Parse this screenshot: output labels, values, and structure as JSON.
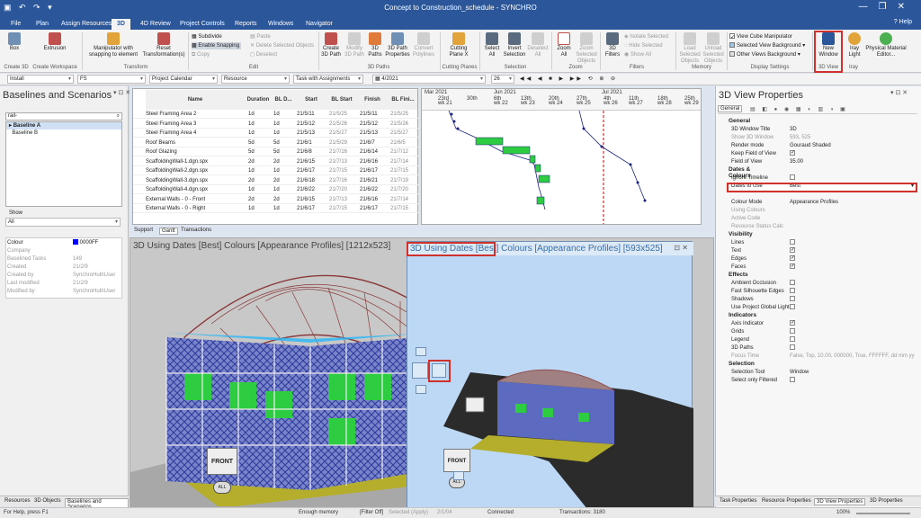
{
  "window": {
    "title": "Concept to Construction_schedule - SYNCHRO",
    "controls": [
      "—",
      "❐",
      "✕"
    ]
  },
  "menu": {
    "tabs": [
      "File",
      "Plan",
      "Assign Resources",
      "3D",
      "4D Review",
      "Project Controls",
      "Reports",
      "Windows",
      "Navigator"
    ],
    "active": "3D",
    "help": "Help"
  },
  "ribbon": {
    "box": "Box",
    "extrusion": "Extrusion",
    "create3d": "Create 3D",
    "create_workspace": "Create Workspace",
    "manipulator": "Manipulator with snapping to element",
    "reset": "Reset Transformation(s)",
    "transform": "Transform",
    "subdivide": "Subdivide",
    "enable_snapping": "Enable Snapping",
    "copy": "Copy",
    "paste": "Paste",
    "delete_selected": "Delete Selected Objects",
    "deselect": "Deselect",
    "edit": "Edit",
    "create_path": "Create 3D Path",
    "modify_path": "Modify 3D Path",
    "paths": "3D Paths",
    "path_props": "3D Path Properties",
    "convert_polylines": "Convert Polylines",
    "paths_group": "3D Paths",
    "cutting_plane": "Cutting Plane X",
    "cutting_planes": "Cutting Planes",
    "select_all": "Select All",
    "invert": "Invert Selection",
    "deselect_all": "Deselect All",
    "selection": "Selection",
    "zoom_all": "Zoom All",
    "zoom_selected": "Zoom Selected Objects",
    "zoom": "Zoom",
    "filters3d": "3D Filters",
    "isolate": "Isolate Selected",
    "hide": "Hide Selected",
    "show_all": "Show All",
    "filters": "Filters",
    "load": "Load Selected Objects",
    "unload": "Unload Selected Objects",
    "memory": "Memory",
    "view_cube": "View Cube Manipulator",
    "sel_bg": "Selected View Background",
    "other_bg": "Other Views Background",
    "display_settings": "Display Settings",
    "new_window": "New Window",
    "view3d": "3D View",
    "iray_light": "Iray Light",
    "iray": "Iray",
    "physical": "Physical Material Editor..."
  },
  "toolbar2": [
    "Install",
    "FS",
    "Project Calendar",
    "Resource",
    "Task with Assignments",
    "4/2021",
    "26"
  ],
  "left_panel": {
    "title": "Baselines and Scenarios",
    "search": "rail-",
    "baselines": [
      "Baseline A",
      "Baseline B"
    ],
    "show_label": "Show",
    "show_value": "All",
    "props": [
      {
        "k": "Colour",
        "v": "0000FF"
      },
      {
        "k": "Company",
        "v": ""
      },
      {
        "k": "Baselined Tasks",
        "v": "149"
      },
      {
        "k": "Created",
        "v": "21/2/9"
      },
      {
        "k": "Created by",
        "v": "SynchroHub\\User"
      },
      {
        "k": "Last modified",
        "v": "21/2/9"
      },
      {
        "k": "Modified by",
        "v": "SynchroHub\\User"
      }
    ],
    "tabs": [
      "Resources",
      "3D Objects",
      "Baselines and Scenarios"
    ]
  },
  "grid": {
    "headers": [
      "Name",
      "Duration",
      "BL D...",
      "Start",
      "BL Start",
      "Finish",
      "BL Fini..."
    ],
    "rows": [
      [
        "Steel Framing Area 2",
        "1d",
        "1d",
        "21/5/11",
        "21/5/25",
        "21/5/11",
        "21/5/25"
      ],
      [
        "Steel Framing Area 3",
        "1d",
        "1d",
        "21/5/12",
        "21/5/26",
        "21/5/12",
        "21/5/26"
      ],
      [
        "Steel Framing Area 4",
        "1d",
        "1d",
        "21/5/13",
        "21/5/27",
        "21/5/13",
        "21/5/27"
      ],
      [
        "Roof Beams",
        "5d",
        "5d",
        "21/6/1",
        "21/5/29",
        "21/6/7",
        "21/6/5"
      ],
      [
        "Roof Glazing",
        "5d",
        "5d",
        "21/6/8",
        "21/7/16",
        "21/6/14",
        "21/7/12"
      ],
      [
        "ScaffoldingWall-1.dgn.spx",
        "2d",
        "2d",
        "21/6/15",
        "21/7/13",
        "21/6/16",
        "21/7/14"
      ],
      [
        "ScaffoldingWall-2.dgn.spx",
        "1d",
        "1d",
        "21/6/17",
        "21/7/15",
        "21/6/17",
        "21/7/15"
      ],
      [
        "ScaffoldingWall-3.dgn.spx",
        "2d",
        "2d",
        "21/6/18",
        "21/7/16",
        "21/6/21",
        "21/7/19"
      ],
      [
        "ScaffoldingWall-4.dgn.spx",
        "1d",
        "1d",
        "21/6/22",
        "21/7/20",
        "21/6/22",
        "21/7/20"
      ],
      [
        "External Walls - 0 - Front",
        "2d",
        "2d",
        "21/6/15",
        "21/7/13",
        "21/6/16",
        "21/7/14"
      ],
      [
        "External Walls - 0 - Right",
        "1d",
        "1d",
        "21/6/17",
        "21/7/15",
        "21/6/17",
        "21/7/15"
      ]
    ],
    "subtabs": [
      "Support",
      "Gantt",
      "Transactions"
    ]
  },
  "gantt": {
    "months": [
      "Mar 2021",
      "Jun 2021",
      "Jul 2021"
    ],
    "days": [
      "23rd",
      "30th",
      "6th",
      "13th",
      "20th",
      "27th",
      "4th",
      "11th",
      "18th",
      "25th"
    ],
    "weeks": [
      "wk 21",
      "wk 22",
      "wk 23",
      "wk 24",
      "wk 25",
      "wk 26",
      "wk 27",
      "wk 28",
      "wk 29"
    ]
  },
  "view3d": {
    "title": "3D Using Dates [Best]  Colours [Appearance Profiles]  [1212x523]",
    "front": "FRONT",
    "all": "ALL"
  },
  "float": {
    "title_red": "3D Using Dates [Best]",
    "title_rest": " Colours [Appearance Profiles]  [593x525]",
    "front": "FRONT",
    "all": "ALL"
  },
  "right_panel": {
    "title": "3D View Properties",
    "tab": "General",
    "sections": [
      {
        "name": "General",
        "rows": [
          {
            "k": "3D Window Title",
            "v": "3D"
          },
          {
            "k": "Show 3D Window",
            "v": "593, 525",
            "dis": true
          },
          {
            "k": "Render mode",
            "v": "Gouraud Shaded"
          },
          {
            "k": "Keep Field of View",
            "v": "✓",
            "chk": true
          },
          {
            "k": "Field of View",
            "v": "35.00"
          }
        ]
      },
      {
        "name": "Dates & Colours",
        "rows": [
          {
            "k": "Ignore Timeline",
            "v": "",
            "chk": true
          },
          {
            "k": "Dates to Use",
            "v": "Best",
            "sel": true
          },
          {
            "k": "",
            "v": ""
          },
          {
            "k": "Colour Mode",
            "v": "Appearance Profiles"
          },
          {
            "k": "Using Colours",
            "v": "",
            "dis": true
          },
          {
            "k": "Active Code",
            "v": "",
            "dis": true
          },
          {
            "k": "Resource Status Calc",
            "v": "",
            "dis": true
          }
        ]
      },
      {
        "name": "Visibility",
        "rows": [
          {
            "k": "Lines",
            "v": "",
            "chk": true
          },
          {
            "k": "Text",
            "v": "✓",
            "chk": true
          },
          {
            "k": "Edges",
            "v": "✓",
            "chk": true
          },
          {
            "k": "Faces",
            "v": "✓",
            "chk": true
          }
        ]
      },
      {
        "name": "Effects",
        "rows": [
          {
            "k": "Ambient Occlusion",
            "v": "",
            "chk": true
          },
          {
            "k": "Fast Silhouette Edges",
            "v": "",
            "chk": true
          },
          {
            "k": "Shadows",
            "v": "",
            "chk": true
          },
          {
            "k": "Use Project Global Light",
            "v": "",
            "chk": true
          }
        ]
      },
      {
        "name": "Indicators",
        "rows": [
          {
            "k": "Axis Indicator",
            "v": "✓",
            "chk": true
          },
          {
            "k": "Grids",
            "v": "",
            "chk": true
          },
          {
            "k": "Legend",
            "v": "",
            "chk": true
          },
          {
            "k": "3D Paths",
            "v": "",
            "chk": true
          },
          {
            "k": "Focus Time",
            "v": "False, Top, 10.00, 000000, True, FFFFFF, dd mm yy",
            "dis": true
          }
        ]
      },
      {
        "name": "Selection",
        "rows": [
          {
            "k": "Selection Tool",
            "v": "Window"
          },
          {
            "k": "Select only Filtered",
            "v": "",
            "chk": true
          }
        ]
      }
    ],
    "tabs": [
      "Task Properties",
      "Resource Properties",
      "3D View Properties",
      "3D Properties"
    ]
  },
  "status": {
    "help": "For Help, press F1",
    "memory": "Enough memory",
    "filter": "[Filter Off]",
    "selected": "Selected (Apply)",
    "count": "2/1/04",
    "connected": "Connected",
    "transactions": "Transactions: 3180",
    "zoom": "100%"
  },
  "colors": {
    "accent": "#2b579a",
    "highlight": "#d0312d",
    "bar": "#2ecc40"
  }
}
